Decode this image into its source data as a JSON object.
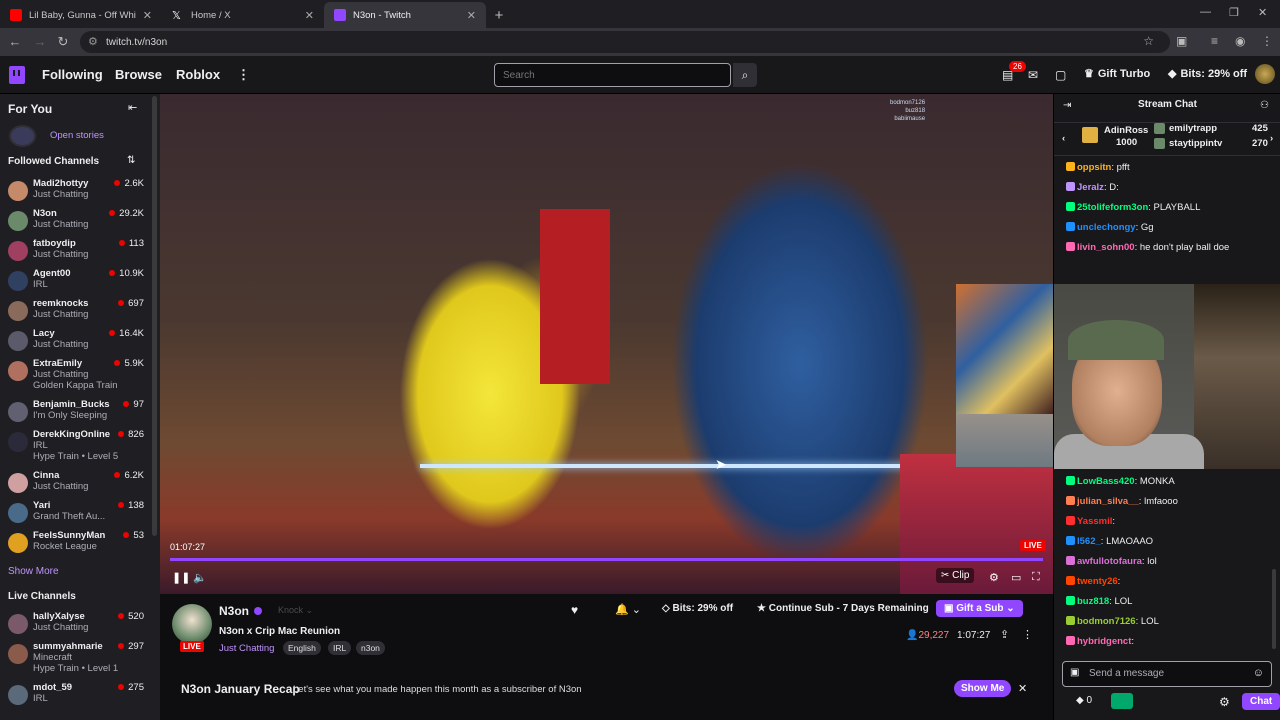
{
  "browser": {
    "tabs": [
      {
        "title": "Lil Baby, Gunna - Off White VL",
        "color": "#ff0000"
      },
      {
        "title": "Home / X",
        "color": "#000000"
      },
      {
        "title": "N3on - Twitch",
        "color": "#9147ff"
      }
    ],
    "url": "twitch.tv/n3on"
  },
  "topnav": {
    "following": "Following",
    "browse": "Browse",
    "roblox": "Roblox",
    "search_placeholder": "Search",
    "notif_count": "26",
    "gift_turbo": "Gift Turbo",
    "bits_off": "Bits: 29% off"
  },
  "sidebar": {
    "for_you": "For You",
    "open_stories": "Open stories",
    "followed": "Followed Channels",
    "followed_channels": [
      {
        "name": "Madi2hottyy",
        "game": "Just Chatting",
        "viewers": "2.6K",
        "color": "#c48a6a"
      },
      {
        "name": "N3on",
        "game": "Just Chatting",
        "viewers": "29.2K",
        "color": "#6a8a6a"
      },
      {
        "name": "fatboydip",
        "game": "Just Chatting",
        "viewers": "113",
        "color": "#a04060"
      },
      {
        "name": "Agent00",
        "game": "IRL",
        "viewers": "10.9K",
        "color": "#304060"
      },
      {
        "name": "reemknocks",
        "game": "Just Chatting",
        "viewers": "697",
        "color": "#8a6a5a"
      },
      {
        "name": "Lacy",
        "game": "Just Chatting",
        "viewers": "16.4K",
        "color": "#5a5a6a"
      },
      {
        "name": "ExtraEmily",
        "game": "Just Chatting",
        "viewers": "5.9K",
        "extra": "Golden Kappa Train",
        "color": "#b07060"
      },
      {
        "name": "Benjamin_Bucks",
        "game": "I'm Only Sleeping",
        "viewers": "97",
        "color": "#606070"
      },
      {
        "name": "DerekKingOnline",
        "game": "IRL",
        "viewers": "826",
        "extra": "Hype Train • Level 5",
        "color": "#2a2a3a"
      },
      {
        "name": "Cinna",
        "game": "Just Chatting",
        "viewers": "6.2K",
        "color": "#d0a0a0"
      },
      {
        "name": "Yari",
        "game": "Grand Theft Au...",
        "viewers": "138",
        "color": "#4a6a8a"
      },
      {
        "name": "FeelsSunnyMan",
        "game": "Rocket League",
        "viewers": "53",
        "color": "#e0a020"
      }
    ],
    "show_more": "Show More",
    "live_channels": "Live Channels",
    "live": [
      {
        "name": "hallyXalyse",
        "game": "Just Chatting",
        "viewers": "520",
        "color": "#7a5a6a"
      },
      {
        "name": "summyahmarie",
        "game": "Minecraft",
        "viewers": "297",
        "extra": "Hype Train • Level 1",
        "color": "#8a5a4a"
      },
      {
        "name": "mdot_59",
        "game": "IRL",
        "viewers": "275",
        "color": "#5a6a7a"
      }
    ]
  },
  "player": {
    "timestamp": "01:07:27",
    "live": "LIVE",
    "clip": "Clip",
    "overlay_names": [
      "bodmon7126",
      "buz818",
      "babiimause"
    ]
  },
  "stream": {
    "name": "N3on",
    "knock": "Knock",
    "title": "N3on x Crip Mac Reunion",
    "live": "LIVE",
    "category": "Just Chatting",
    "tags": [
      "English",
      "IRL",
      "n3on"
    ],
    "bits": "Bits: 29% off",
    "continue_sub": "Continue Sub - 7 Days Remaining",
    "gift_sub": "Gift a Sub",
    "viewers": "29,227",
    "uptime": "1:07:27"
  },
  "recap": {
    "title": "N3on January Recap",
    "desc": "Let's see what you made happen this month as a subscriber of N3on",
    "button": "Show Me"
  },
  "chat": {
    "header": "Stream Chat",
    "gifters": [
      {
        "name": "AdinRoss",
        "count": "1000"
      },
      {
        "name": "emilytrapp",
        "count": "425"
      },
      {
        "name": "staytippintv",
        "count": "270"
      }
    ],
    "messages_top": [
      {
        "user": "oppsitn",
        "text": "pfft",
        "color": "#ffb31a"
      },
      {
        "user": "Jeralz",
        "text": "D:",
        "color": "#bf94ff"
      },
      {
        "user": "25tolifeform3on",
        "text": "PLAYBALL",
        "color": "#00ff7f"
      },
      {
        "user": "unclechongy",
        "text": "Gg",
        "color": "#1e90ff"
      },
      {
        "user": "livin_sohn00",
        "text": "he don't play ball doe",
        "color": "#ff69b4"
      }
    ],
    "messages_bottom": [
      {
        "user": "LowBass420",
        "text": "MONKA",
        "color": "#00ff7f"
      },
      {
        "user": "julian_silva__",
        "text": "lmfaooo",
        "color": "#ff7f50"
      },
      {
        "user": "Yassmil",
        "text": "",
        "color": "#ff2f2f"
      },
      {
        "user": "l562_",
        "text": "LMAOAAO",
        "color": "#1e90ff"
      },
      {
        "user": "awfullotofaura",
        "text": "lol",
        "color": "#da70d6"
      },
      {
        "user": "twenty26",
        "text": "",
        "color": "#ff4500"
      },
      {
        "user": "buz818",
        "text": "LOL",
        "color": "#00ff7f"
      },
      {
        "user": "bodmon7126",
        "text": "LOL",
        "color": "#9acd32"
      },
      {
        "user": "hybridgenct",
        "text": "",
        "color": "#ff69b4"
      }
    ],
    "input_placeholder": "Send a message",
    "bits_count": "0",
    "chat_button": "Chat"
  }
}
